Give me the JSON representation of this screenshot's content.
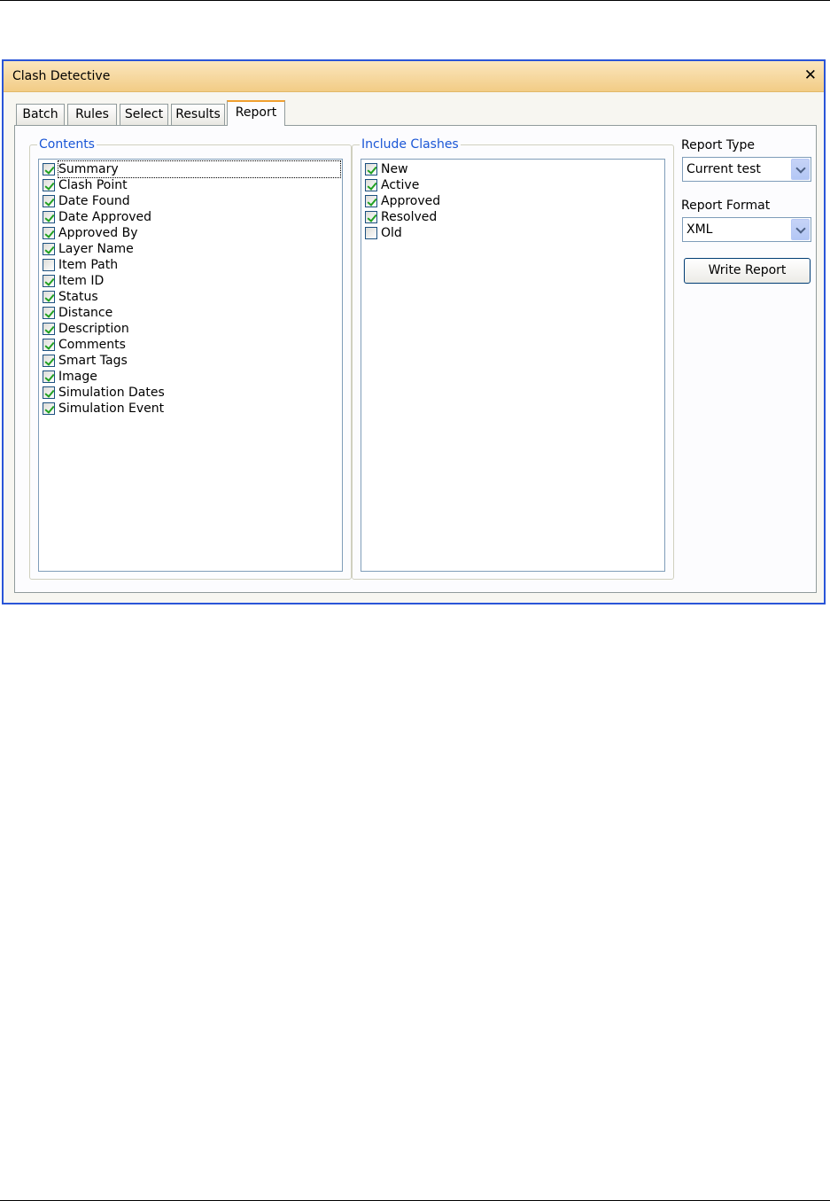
{
  "window": {
    "title": "Clash Detective"
  },
  "tabs": [
    {
      "label": "Batch"
    },
    {
      "label": "Rules"
    },
    {
      "label": "Select"
    },
    {
      "label": "Results"
    },
    {
      "label": "Report",
      "active": true
    }
  ],
  "contents": {
    "legend": "Contents",
    "items": [
      {
        "label": "Summary",
        "checked": true
      },
      {
        "label": "Clash Point",
        "checked": true
      },
      {
        "label": "Date Found",
        "checked": true
      },
      {
        "label": "Date Approved",
        "checked": true
      },
      {
        "label": "Approved By",
        "checked": true
      },
      {
        "label": "Layer Name",
        "checked": true
      },
      {
        "label": "Item Path",
        "checked": false
      },
      {
        "label": "Item ID",
        "checked": true
      },
      {
        "label": "Status",
        "checked": true
      },
      {
        "label": "Distance",
        "checked": true
      },
      {
        "label": "Description",
        "checked": true
      },
      {
        "label": "Comments",
        "checked": true
      },
      {
        "label": "Smart Tags",
        "checked": true
      },
      {
        "label": "Image",
        "checked": true
      },
      {
        "label": "Simulation Dates",
        "checked": true
      },
      {
        "label": "Simulation Event",
        "checked": true
      }
    ]
  },
  "include_clashes": {
    "legend": "Include Clashes",
    "items": [
      {
        "label": "New",
        "checked": true
      },
      {
        "label": "Active",
        "checked": true
      },
      {
        "label": "Approved",
        "checked": true
      },
      {
        "label": "Resolved",
        "checked": true
      },
      {
        "label": "Old",
        "checked": false
      }
    ]
  },
  "report_type": {
    "label": "Report Type",
    "value": "Current test"
  },
  "report_format": {
    "label": "Report Format",
    "value": "XML"
  },
  "write_report": {
    "label": "Write Report"
  },
  "colors": {
    "window_border": "#2a55d8",
    "legend_text": "#1a56d6",
    "check": "#21a121",
    "tab_highlight": "#f0a030"
  }
}
